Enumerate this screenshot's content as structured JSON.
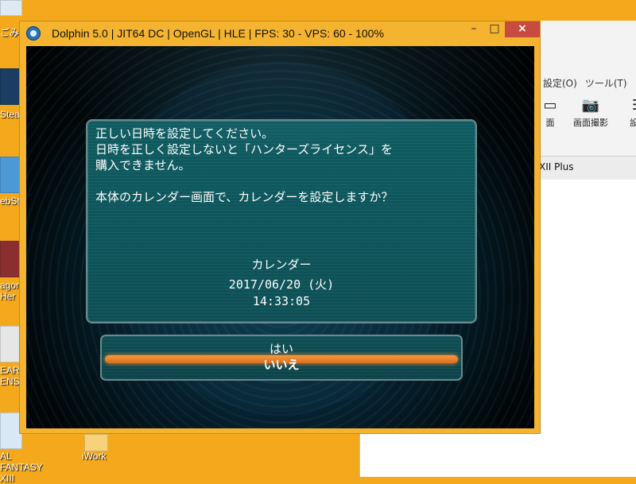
{
  "desktop": {
    "background": "#f4a81b",
    "icons": [
      {
        "label": "ごみ"
      },
      {
        "label": "Stea"
      },
      {
        "label": "ebSt"
      },
      {
        "label": "agon\nHer"
      },
      {
        "label": "EAR\nENS"
      },
      {
        "label": "AL FANTASY\nXIII"
      }
    ],
    "iwork": {
      "label": "iWork"
    }
  },
  "side_app": {
    "menu_settings": "設定(O)",
    "menu_tools": "ツール(T)",
    "toolbar_capture": "画面撮影",
    "toolbar_settings": "設定",
    "toolbar_partial": "面",
    "content_text": "XII Plus"
  },
  "dolphin": {
    "title": "Dolphin 5.0 | JIT64 DC | OpenGL | HLE | FPS: 30 - VPS: 60 - 100%",
    "controls": {
      "minimize": "–",
      "maximize": "□",
      "close": "×"
    },
    "dialog": {
      "message": "正しい日時を設定してください。\n日時を正しく設定しないと「ハンターズライセンス」を\n購入できません。\n\n本体のカレンダー画面で、カレンダーを設定しますか？",
      "calendar_label": "カレンダー",
      "date": "2017/06/20 (火)",
      "time": "14:33:05"
    },
    "choices": {
      "yes": "はい",
      "no": "いいえ"
    }
  }
}
